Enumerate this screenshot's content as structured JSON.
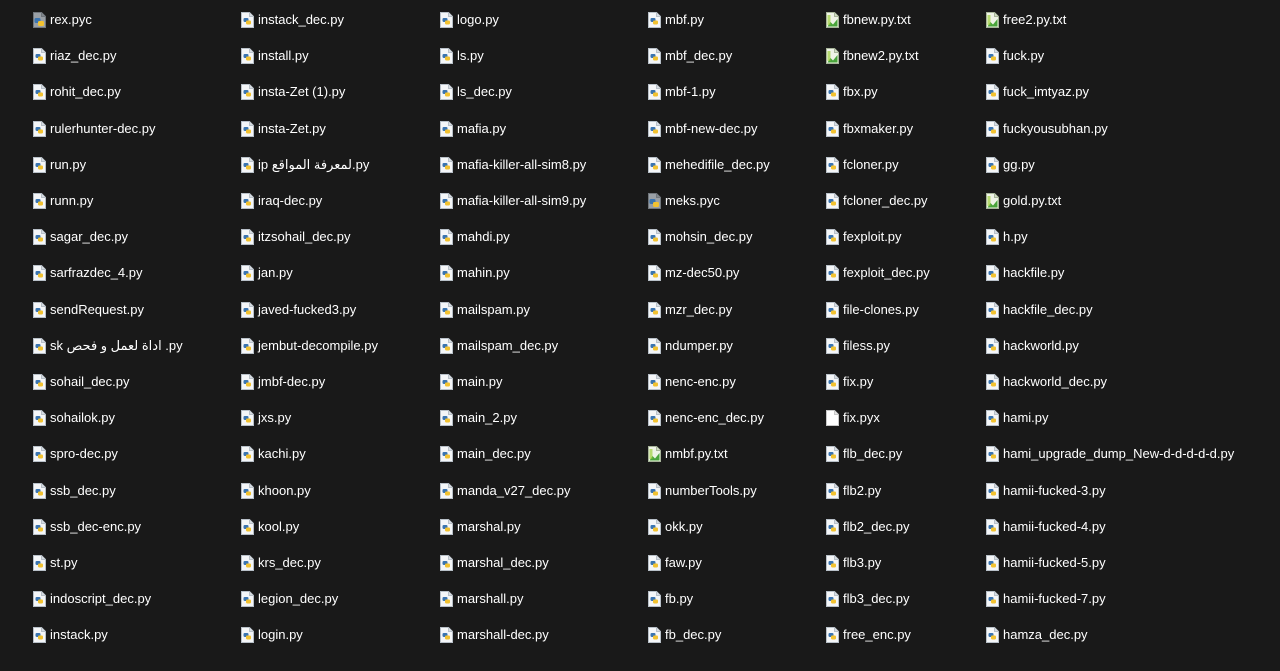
{
  "columns": [
    [
      {
        "name": "rex.pyc",
        "icon": "python-compiled-icon"
      },
      {
        "name": "riaz_dec.py",
        "icon": "python-file-icon"
      },
      {
        "name": "rohit_dec.py",
        "icon": "python-file-icon"
      },
      {
        "name": "rulerhunter-dec.py",
        "icon": "python-file-icon"
      },
      {
        "name": "run.py",
        "icon": "python-file-icon"
      },
      {
        "name": "runn.py",
        "icon": "python-file-icon"
      },
      {
        "name": "sagar_dec.py",
        "icon": "python-file-icon"
      },
      {
        "name": "sarfrazdec_4.py",
        "icon": "python-file-icon"
      },
      {
        "name": "sendRequest.py",
        "icon": "python-file-icon"
      },
      {
        "name": "sk اداة لعمل و فحص .py",
        "icon": "python-file-icon"
      },
      {
        "name": "sohail_dec.py",
        "icon": "python-file-icon"
      },
      {
        "name": "sohailok.py",
        "icon": "python-file-icon"
      },
      {
        "name": "spro-dec.py",
        "icon": "python-file-icon"
      },
      {
        "name": "ssb_dec.py",
        "icon": "python-file-icon"
      },
      {
        "name": "ssb_dec-enc.py",
        "icon": "python-file-icon"
      },
      {
        "name": "st.py",
        "icon": "python-file-icon"
      },
      {
        "name": "indoscript_dec.py",
        "icon": "python-file-icon"
      },
      {
        "name": "instack.py",
        "icon": "python-file-icon"
      }
    ],
    [
      {
        "name": "instack_dec.py",
        "icon": "python-file-icon"
      },
      {
        "name": "install.py",
        "icon": "python-file-icon"
      },
      {
        "name": "insta-Zet (1).py",
        "icon": "python-file-icon"
      },
      {
        "name": "insta-Zet.py",
        "icon": "python-file-icon"
      },
      {
        "name": "ip لمعرفة المواقع.py",
        "icon": "python-file-icon"
      },
      {
        "name": "iraq-dec.py",
        "icon": "python-file-icon"
      },
      {
        "name": "itzsohail_dec.py",
        "icon": "python-file-icon"
      },
      {
        "name": "jan.py",
        "icon": "python-file-icon"
      },
      {
        "name": "javed-fucked3.py",
        "icon": "python-file-icon"
      },
      {
        "name": "jembut-decompile.py",
        "icon": "python-file-icon"
      },
      {
        "name": "jmbf-dec.py",
        "icon": "python-file-icon"
      },
      {
        "name": "jxs.py",
        "icon": "python-file-icon"
      },
      {
        "name": "kachi.py",
        "icon": "python-file-icon"
      },
      {
        "name": "khoon.py",
        "icon": "python-file-icon"
      },
      {
        "name": "kool.py",
        "icon": "python-file-icon"
      },
      {
        "name": "krs_dec.py",
        "icon": "python-file-icon"
      },
      {
        "name": "legion_dec.py",
        "icon": "python-file-icon"
      },
      {
        "name": "login.py",
        "icon": "python-file-icon"
      }
    ],
    [
      {
        "name": "logo.py",
        "icon": "python-file-icon"
      },
      {
        "name": "ls.py",
        "icon": "python-file-icon"
      },
      {
        "name": "ls_dec.py",
        "icon": "python-file-icon"
      },
      {
        "name": "mafia.py",
        "icon": "python-file-icon"
      },
      {
        "name": "mafia-killer-all-sim8.py",
        "icon": "python-file-icon"
      },
      {
        "name": "mafia-killer-all-sim9.py",
        "icon": "python-file-icon"
      },
      {
        "name": "mahdi.py",
        "icon": "python-file-icon"
      },
      {
        "name": "mahin.py",
        "icon": "python-file-icon"
      },
      {
        "name": "mailspam.py",
        "icon": "python-file-icon"
      },
      {
        "name": "mailspam_dec.py",
        "icon": "python-file-icon"
      },
      {
        "name": "main.py",
        "icon": "python-file-icon"
      },
      {
        "name": "main_2.py",
        "icon": "python-file-icon"
      },
      {
        "name": "main_dec.py",
        "icon": "python-file-icon"
      },
      {
        "name": "manda_v27_dec.py",
        "icon": "python-file-icon"
      },
      {
        "name": "marshal.py",
        "icon": "python-file-icon"
      },
      {
        "name": "marshal_dec.py",
        "icon": "python-file-icon"
      },
      {
        "name": "marshall.py",
        "icon": "python-file-icon"
      },
      {
        "name": "marshall-dec.py",
        "icon": "python-file-icon"
      }
    ],
    [
      {
        "name": "mbf.py",
        "icon": "python-file-icon"
      },
      {
        "name": "mbf_dec.py",
        "icon": "python-file-icon"
      },
      {
        "name": "mbf-1.py",
        "icon": "python-file-icon"
      },
      {
        "name": "mbf-new-dec.py",
        "icon": "python-file-icon"
      },
      {
        "name": "mehedifile_dec.py",
        "icon": "python-file-icon"
      },
      {
        "name": "meks.pyc",
        "icon": "python-compiled-icon"
      },
      {
        "name": "mohsin_dec.py",
        "icon": "python-file-icon"
      },
      {
        "name": "mz-dec50.py",
        "icon": "python-file-icon"
      },
      {
        "name": "mzr_dec.py",
        "icon": "python-file-icon"
      },
      {
        "name": "ndumper.py",
        "icon": "python-file-icon"
      },
      {
        "name": "nenc-enc.py",
        "icon": "python-file-icon"
      },
      {
        "name": "nenc-enc_dec.py",
        "icon": "python-file-icon"
      },
      {
        "name": "nmbf.py.txt",
        "icon": "text-file-icon"
      },
      {
        "name": "numberTools.py",
        "icon": "python-file-icon"
      },
      {
        "name": "okk.py",
        "icon": "python-file-icon"
      },
      {
        "name": "faw.py",
        "icon": "python-file-icon"
      },
      {
        "name": "fb.py",
        "icon": "python-file-icon"
      },
      {
        "name": "fb_dec.py",
        "icon": "python-file-icon"
      }
    ],
    [
      {
        "name": "fbnew.py.txt",
        "icon": "text-file-icon"
      },
      {
        "name": "fbnew2.py.txt",
        "icon": "text-file-icon"
      },
      {
        "name": "fbx.py",
        "icon": "python-file-icon"
      },
      {
        "name": "fbxmaker.py",
        "icon": "python-file-icon"
      },
      {
        "name": "fcloner.py",
        "icon": "python-file-icon"
      },
      {
        "name": "fcloner_dec.py",
        "icon": "python-file-icon"
      },
      {
        "name": "fexploit.py",
        "icon": "python-file-icon"
      },
      {
        "name": "fexploit_dec.py",
        "icon": "python-file-icon"
      },
      {
        "name": "file-clones.py",
        "icon": "python-file-icon"
      },
      {
        "name": "filess.py",
        "icon": "python-file-icon"
      },
      {
        "name": "fix.py",
        "icon": "python-file-icon"
      },
      {
        "name": "fix.pyx",
        "icon": "blank-file-icon"
      },
      {
        "name": "flb_dec.py",
        "icon": "python-file-icon"
      },
      {
        "name": "flb2.py",
        "icon": "python-file-icon"
      },
      {
        "name": "flb2_dec.py",
        "icon": "python-file-icon"
      },
      {
        "name": "flb3.py",
        "icon": "python-file-icon"
      },
      {
        "name": "flb3_dec.py",
        "icon": "python-file-icon"
      },
      {
        "name": "free_enc.py",
        "icon": "python-file-icon"
      }
    ],
    [
      {
        "name": "free2.py.txt",
        "icon": "text-file-icon"
      },
      {
        "name": "fuck.py",
        "icon": "python-file-icon"
      },
      {
        "name": "fuck_imtyaz.py",
        "icon": "python-file-icon"
      },
      {
        "name": "fuckyousubhan.py",
        "icon": "python-file-icon"
      },
      {
        "name": "gg.py",
        "icon": "python-file-icon"
      },
      {
        "name": "gold.py.txt",
        "icon": "text-file-icon"
      },
      {
        "name": "h.py",
        "icon": "python-file-icon"
      },
      {
        "name": "hackfile.py",
        "icon": "python-file-icon"
      },
      {
        "name": "hackfile_dec.py",
        "icon": "python-file-icon"
      },
      {
        "name": "hackworld.py",
        "icon": "python-file-icon"
      },
      {
        "name": "hackworld_dec.py",
        "icon": "python-file-icon"
      },
      {
        "name": "hami.py",
        "icon": "python-file-icon"
      },
      {
        "name": "hami_upgrade_dump_New-d-d-d-d-d.py",
        "icon": "python-file-icon"
      },
      {
        "name": "hamii-fucked-3.py",
        "icon": "python-file-icon"
      },
      {
        "name": "hamii-fucked-4.py",
        "icon": "python-file-icon"
      },
      {
        "name": "hamii-fucked-5.py",
        "icon": "python-file-icon"
      },
      {
        "name": "hamii-fucked-7.py",
        "icon": "python-file-icon"
      },
      {
        "name": "hamza_dec.py",
        "icon": "python-file-icon"
      }
    ]
  ]
}
